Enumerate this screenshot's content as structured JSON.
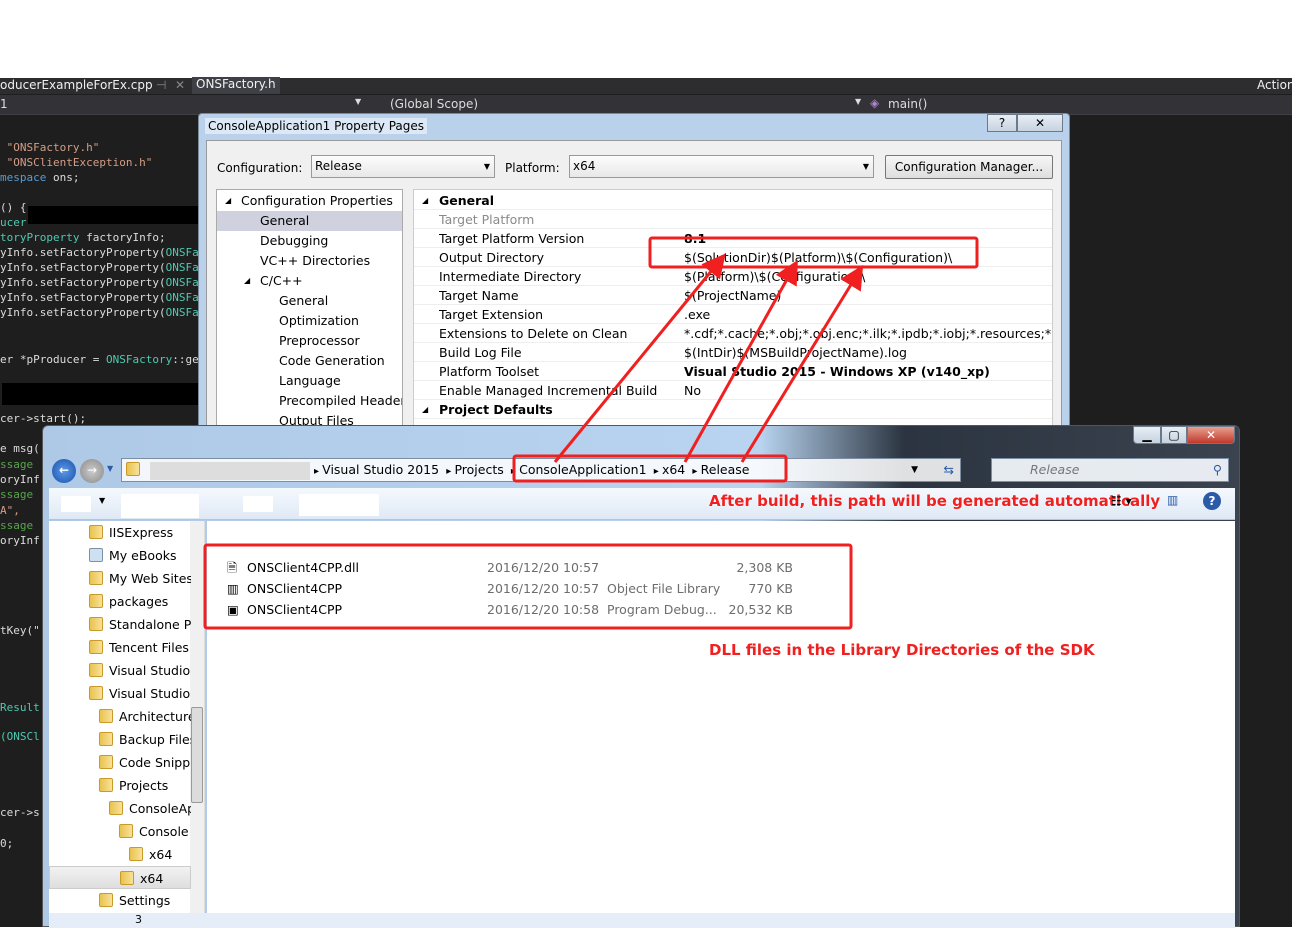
{
  "ide": {
    "tabs": [
      "oducerExampleForEx.cpp",
      "ONSFactory.h"
    ],
    "pin_icon": "pin-icon",
    "close_icon": "close-icon",
    "project_combo": "1",
    "scope_combo": "(Global Scope)",
    "member_combo": "main()",
    "action_label": "Action",
    "code_lines": [
      {
        "t": " \"ONSFactory.h\"",
        "c": "str"
      },
      {
        "t": " \"ONSClientException.h\"",
        "c": "str"
      },
      {
        "t": "mespace",
        "c": "kw",
        "rest": " ons;"
      },
      {
        "t": "() {",
        "c": ""
      },
      {
        "t": "ucer",
        "c": "ty"
      },
      {
        "t": "toryProperty",
        "c": "ty",
        "rest": " factoryInfo;"
      },
      {
        "t": "yInfo.setFactoryProperty(",
        "c": "",
        "rest2": "ONSFac"
      },
      {
        "t": "yInfo.setFactoryProperty(",
        "c": "",
        "rest2": "ONSFac"
      },
      {
        "t": "yInfo.setFactoryProperty(",
        "c": "",
        "rest2": "ONSFac"
      },
      {
        "t": "yInfo.setFactoryProperty(",
        "c": "",
        "rest2": "ONSFac"
      },
      {
        "t": "yInfo.setFactoryProperty(",
        "c": "",
        "rest2": "ONSFac"
      },
      {
        "t": "er *pProducer = ",
        "c": "",
        "rest2": "ONSFactory",
        "rest3": "::get"
      },
      {
        "t": "cer->start();",
        "c": ""
      },
      {
        "t": "e msg(",
        "c": ""
      },
      {
        "t": "ssage",
        "c": "cm"
      },
      {
        "t": "oryInf",
        "c": ""
      },
      {
        "t": "ssage",
        "c": "cm"
      },
      {
        "t": "A\",",
        "c": "str"
      },
      {
        "t": "ssage",
        "c": "cm"
      },
      {
        "t": "oryInf",
        "c": ""
      },
      {
        "t": "tKey(\"",
        "c": ""
      },
      {
        "t": "Result",
        "c": "ty"
      },
      {
        "t": "(ONSCl",
        "c": "ty"
      },
      {
        "t": "cer->s",
        "c": ""
      },
      {
        "t": "0;",
        "c": ""
      }
    ]
  },
  "dialog": {
    "title": "ConsoleApplication1 Property Pages",
    "help_label": "?",
    "close_label": "✕",
    "configuration_label": "Configuration:",
    "configuration_value": "Release",
    "platform_label": "Platform:",
    "platform_value": "x64",
    "config_manager_label": "Configuration Manager...",
    "tree": [
      "Configuration Properties",
      "General",
      "Debugging",
      "VC++ Directories",
      "C/C++",
      "General",
      "Optimization",
      "Preprocessor",
      "Code Generation",
      "Language",
      "Precompiled Header",
      "Output Files"
    ],
    "section_general": "General",
    "rows": [
      {
        "k": "Target Platform",
        "v": "",
        "dim": true
      },
      {
        "k": "Target Platform Version",
        "v": "8.1",
        "bold": true
      },
      {
        "k": "Output Directory",
        "v": "$(SolutionDir)$(Platform)\\$(Configuration)\\"
      },
      {
        "k": "Intermediate Directory",
        "v": "$(Platform)\\$(Configuration)\\"
      },
      {
        "k": "Target Name",
        "v": "$(ProjectName)"
      },
      {
        "k": "Target Extension",
        "v": ".exe"
      },
      {
        "k": "Extensions to Delete on Clean",
        "v": "*.cdf;*.cache;*.obj;*.obj.enc;*.ilk;*.ipdb;*.iobj;*.resources;*.tlb;*.tli;*"
      },
      {
        "k": "Build Log File",
        "v": "$(IntDir)$(MSBuildProjectName).log"
      },
      {
        "k": "Platform Toolset",
        "v": "Visual Studio 2015 - Windows XP (v140_xp)",
        "bold": true
      },
      {
        "k": "Enable Managed Incremental Build",
        "v": "No"
      }
    ],
    "section_defaults": "Project Defaults"
  },
  "explorer": {
    "breadcrumb": [
      "Visual Studio 2015",
      "Projects",
      "ConsoleApplication1",
      "x64",
      "Release"
    ],
    "search_placeholder": "Release",
    "nav": [
      {
        "l": "IISExpress",
        "d": 0,
        "icon": "folder-icon"
      },
      {
        "l": "My eBooks",
        "d": 0,
        "icon": "ebooks-icon"
      },
      {
        "l": "My Web Sites",
        "d": 0,
        "icon": "folder-icon"
      },
      {
        "l": "packages",
        "d": 0,
        "icon": "folder-icon"
      },
      {
        "l": "Standalone Pr",
        "d": 0,
        "icon": "folder-icon"
      },
      {
        "l": "Tencent Files",
        "d": 0,
        "icon": "folder-icon"
      },
      {
        "l": "Visual Studio",
        "d": 0,
        "icon": "folder-icon"
      },
      {
        "l": "Visual Studio",
        "d": 0,
        "icon": "folder-icon"
      },
      {
        "l": "Architecture",
        "d": 1,
        "icon": "folder-icon"
      },
      {
        "l": "Backup Files",
        "d": 1,
        "icon": "folder-icon"
      },
      {
        "l": "Code Snipp",
        "d": 1,
        "icon": "folder-icon"
      },
      {
        "l": "Projects",
        "d": 1,
        "icon": "folder-icon"
      },
      {
        "l": "ConsoleAp",
        "d": 2,
        "icon": "folder-icon"
      },
      {
        "l": "Console",
        "d": 3,
        "icon": "folder-icon"
      },
      {
        "l": "x64",
        "d": 4,
        "icon": "folder-icon"
      },
      {
        "l": "x64",
        "d": 3,
        "icon": "folder-icon",
        "sel": true
      },
      {
        "l": "Settings",
        "d": 1,
        "icon": "folder-icon"
      }
    ],
    "files": [
      {
        "name": "ONSClient4CPP.dll",
        "date": "2016/12/20 10:57",
        "type": "",
        "size": "2,308 KB",
        "icon": "dll-file-icon"
      },
      {
        "name": "ONSClient4CPP",
        "date": "2016/12/20 10:57",
        "type": "Object File Library",
        "size": "770 KB",
        "icon": "library-file-icon"
      },
      {
        "name": "ONSClient4CPP",
        "date": "2016/12/20 10:58",
        "type": "Program Debug...",
        "size": "20,532 KB",
        "icon": "pdb-file-icon"
      }
    ],
    "details_text": "3"
  },
  "annotations": {
    "path_note": "After build, this path will be generated automatically",
    "dll_note": "DLL files in the Library Directories of the SDK",
    "color": "#f02020"
  }
}
